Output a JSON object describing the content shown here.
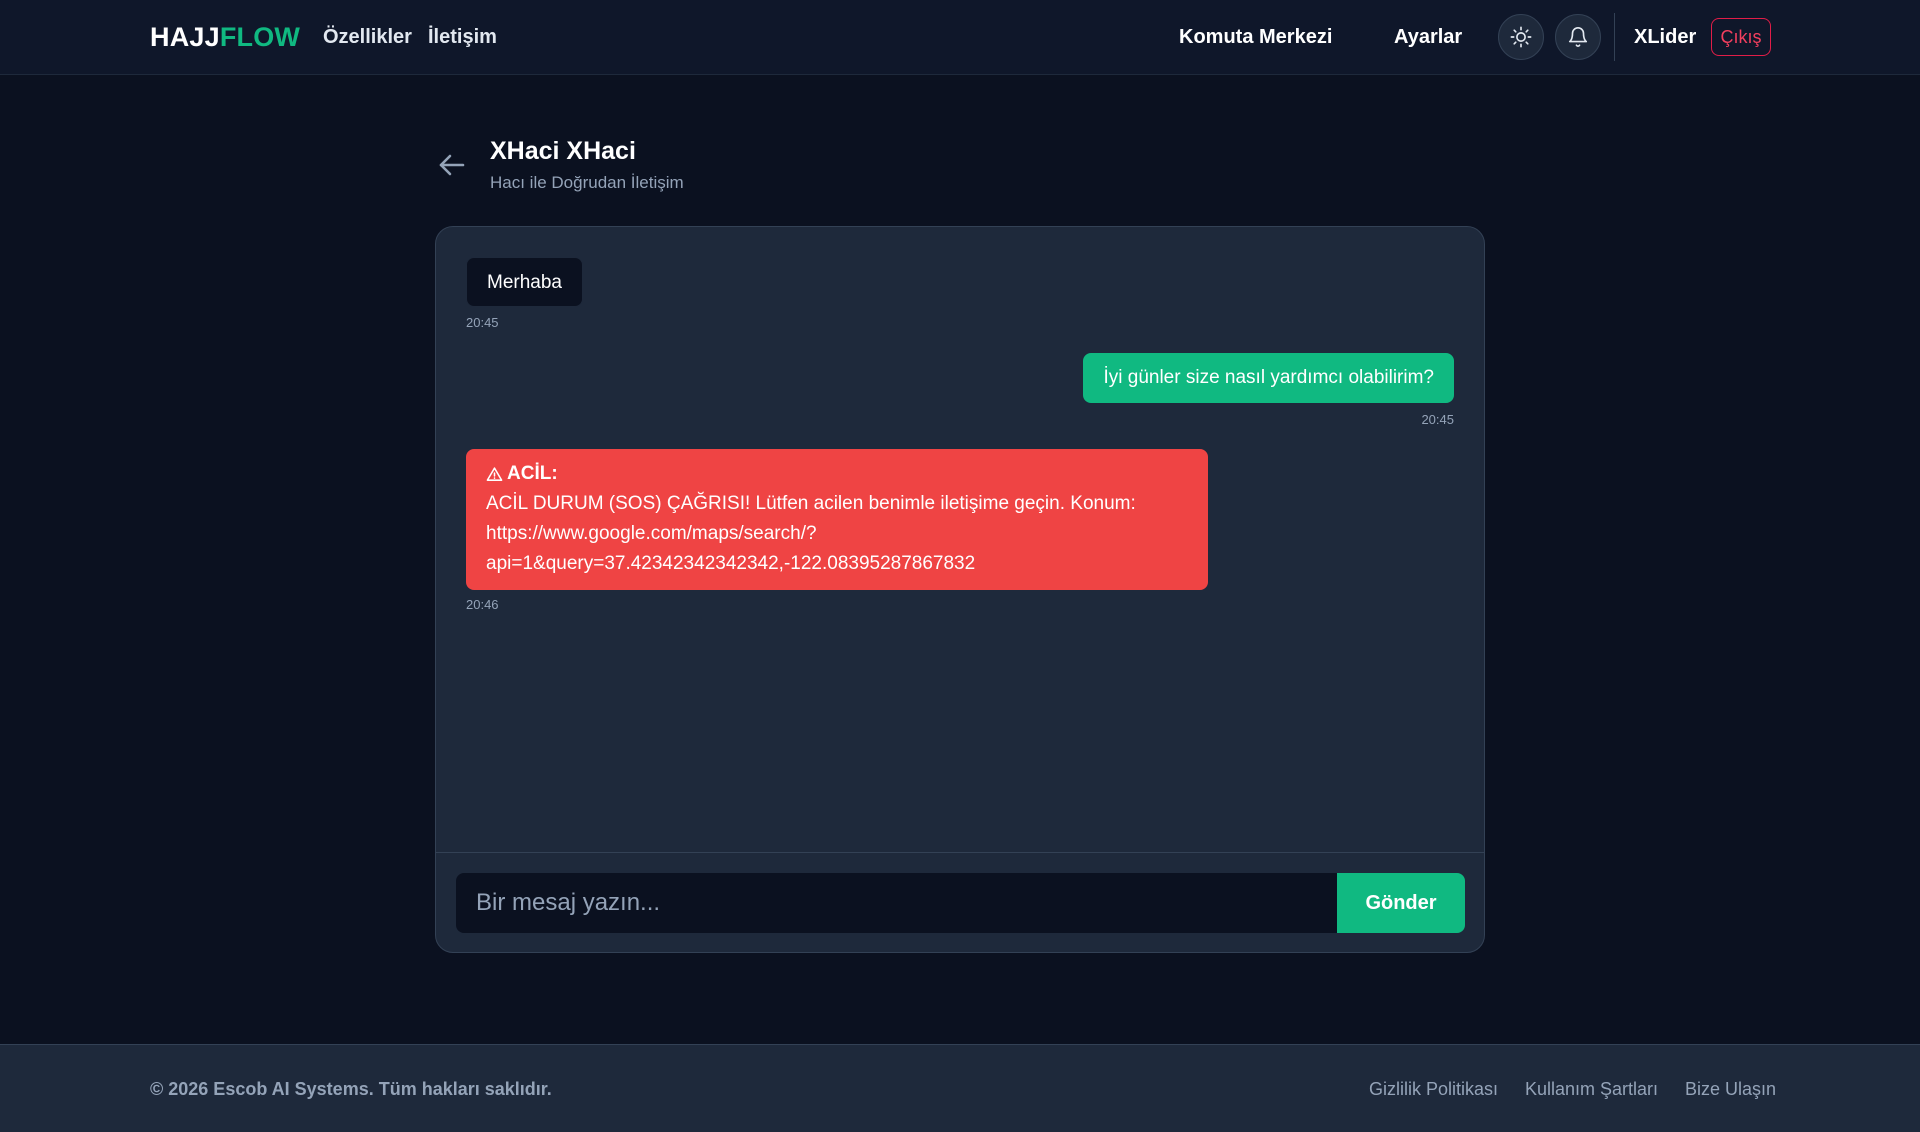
{
  "header": {
    "logo_part1": "HAJJ",
    "logo_part2": "FLOW",
    "nav": [
      "Özellikler",
      "İletişim"
    ],
    "command_center": "Komuta Merkezi",
    "settings": "Ayarlar",
    "theme_icon": "sun-icon",
    "notifications_icon": "bell-icon",
    "username": "XLider",
    "logout": "Çıkış"
  },
  "page": {
    "title": "XHaci XHaci",
    "subtitle": "Hacı ile Doğrudan İletişim"
  },
  "messages": [
    {
      "sender": "other",
      "text": "Merhaba",
      "time": "20:45"
    },
    {
      "sender": "self",
      "text": "İyi günler size nasıl yardımcı olabilirim?",
      "time": "20:45"
    },
    {
      "sender": "other",
      "type": "emergency",
      "label": "ACİL:",
      "text_line1": "ACİL DURUM (SOS) ÇAĞRISI! Lütfen acilen benimle iletişime geçin. Konum:",
      "text_line2": "https://www.google.com/maps/search/?",
      "text_line3": "api=1&query=37.42342342342342,-122.08395287867832",
      "time": "20:46"
    }
  ],
  "composer": {
    "placeholder": "Bir mesaj yazın...",
    "value": "",
    "send_label": "Gönder"
  },
  "footer": {
    "copyright": "© 2026 Escob AI Systems. Tüm hakları saklıdır.",
    "links": [
      "Gizlilik Politikası",
      "Kullanım Şartları",
      "Bize Ulaşın"
    ]
  },
  "colors": {
    "background": "#0b1120",
    "header": "#0f172a",
    "panel": "#1e293b",
    "accent": "#10b981",
    "emergency": "#ef4444",
    "logout": "#e11d48"
  }
}
